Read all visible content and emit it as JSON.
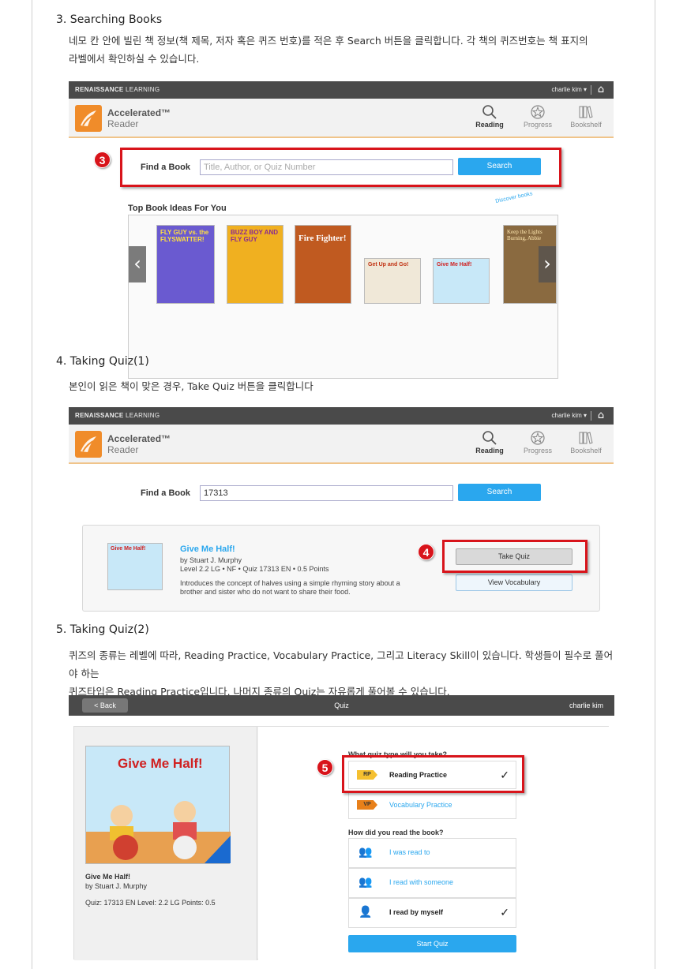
{
  "colors": {
    "accent_blue": "#2aa7ee",
    "highlight_red": "#d8141b",
    "topbar": "#4a4a4a",
    "logo_orange": "#f08c2a"
  },
  "sections": {
    "s3": {
      "title": "3. Searching Books",
      "desc_line1": "네모 칸 안에 빌린 책 정보(책 제목, 저자 혹은 퀴즈 번호)를 적은 후 Search 버튼을 클릭합니다. 각 책의 퀴즈번호는 책 표지의",
      "desc_line2": "라벨에서 확인하실 수 있습니다."
    },
    "s4": {
      "title": "4. Taking Quiz(1)",
      "desc_line1": "본인이 읽은 책이 맞은 경우, Take Quiz 버튼을 클릭합니다"
    },
    "s5": {
      "title": "5. Taking Quiz(2)",
      "desc_line1": "퀴즈의 종류는 레벨에 따라, Reading Practice, Vocabulary Practice, 그리고 Literacy Skill이 있습니다. 학생들이 필수로 풀어야 하는",
      "desc_line2": "퀴즈타입은 Reading Practice입니다. 나머지 종류의 Quiz는 자유롭게 풀어볼 수 있습니다."
    }
  },
  "ar": {
    "brand_bold": "RENAISSANCE",
    "brand_rest": " LEARNING",
    "user": "charlie kim ▾",
    "app_name": "Accelerated™",
    "app_sub": "Reader",
    "nav": [
      {
        "label": "Reading",
        "icon": "search-icon"
      },
      {
        "label": "Progress",
        "icon": "star-icon"
      },
      {
        "label": "Bookshelf",
        "icon": "bookshelf-icon"
      }
    ],
    "find_label": "Find a Book",
    "search_placeholder": "Title, Author, or Quiz Number",
    "search_value": "17313",
    "search_button": "Search",
    "top_ideas": "Top Book Ideas For You",
    "discover": "Discover books",
    "books": [
      {
        "title": "FLY GUY vs. the FLYSWATTER!",
        "cover": "#6a5ad0"
      },
      {
        "title": "BUZZ BOY AND FLY GUY",
        "cover": "#f0b020"
      },
      {
        "title": "Fire Fighter!",
        "cover": "#c05a20"
      },
      {
        "title": "Get Up and Go!",
        "cover": "#f0e8d8"
      },
      {
        "title": "Give Me Half!",
        "cover": "#c8e8f8"
      },
      {
        "title": "Keep the Lights Burning, Abbie",
        "cover": "#8a6a40"
      }
    ]
  },
  "badges": {
    "b3": "3",
    "b4": "4",
    "b5": "5"
  },
  "result": {
    "title": "Give Me Half!",
    "author": "by Stuart J. Murphy",
    "meta": "Level 2.2 LG • NF • Quiz 17313 EN  • 0.5 Points",
    "summary1": "Introduces the concept of halves using a simple rhyming story about a",
    "summary2": "brother and sister who do not want to share their food.",
    "take_quiz": "Take Quiz",
    "view_vocab": "View Vocabulary"
  },
  "quiz": {
    "back": "< Back",
    "title": "Quiz",
    "user": "charlie kim",
    "book_title": "Give Me Half!",
    "book_author": "by Stuart J. Murphy",
    "book_stats": "Quiz: 17313 EN   Level: 2.2 LG   Points: 0.5",
    "question1": "What quiz type will you take?",
    "question2": "How did you read the book?",
    "quiz_types": [
      {
        "tag": "RP",
        "label": "Reading Practice",
        "check": "✓",
        "tag_color": "#f5c030"
      },
      {
        "tag": "VP",
        "label": "Vocabulary Practice",
        "check": "",
        "tag_color": "#e8801a"
      }
    ],
    "read_modes": [
      {
        "label": "I was read to",
        "check": ""
      },
      {
        "label": "I read with someone",
        "check": ""
      },
      {
        "label": "I read by myself",
        "check": "✓"
      }
    ],
    "start": "Start Quiz"
  }
}
